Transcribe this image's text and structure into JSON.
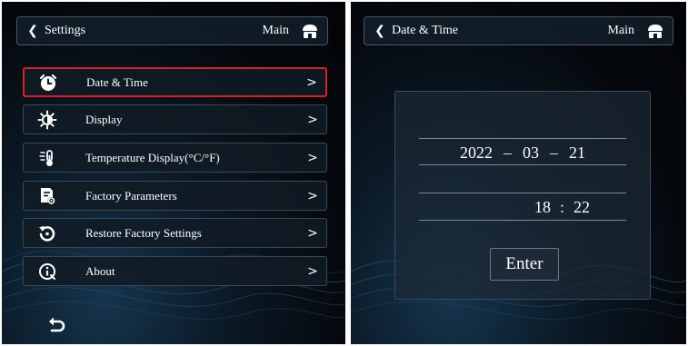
{
  "settings_screen": {
    "header": {
      "title": "Settings",
      "main_label": "Main"
    },
    "menu_items": [
      {
        "label": "Date & Time",
        "icon": "alarm-clock-icon",
        "selected": true
      },
      {
        "label": "Display",
        "icon": "brightness-icon",
        "selected": false
      },
      {
        "label": "Temperature Display(°C/°F)",
        "icon": "thermometer-icon",
        "selected": false
      },
      {
        "label": "Factory Parameters",
        "icon": "factory-settings-icon",
        "selected": false
      },
      {
        "label": "Restore Factory Settings",
        "icon": "restore-icon",
        "selected": false
      },
      {
        "label": "About",
        "icon": "info-icon",
        "selected": false
      }
    ],
    "arrow": ">"
  },
  "datetime_screen": {
    "header": {
      "title": "Date & Time",
      "main_label": "Main"
    },
    "date": {
      "year": "2022",
      "month": "03",
      "day": "21",
      "separator": "–"
    },
    "time": {
      "hour": "18",
      "minute": "22",
      "separator": ":"
    },
    "enter_label": "Enter"
  },
  "colors": {
    "selected_border": "#d5232a",
    "panel_background": "#05090e",
    "text": "#ffffff"
  }
}
